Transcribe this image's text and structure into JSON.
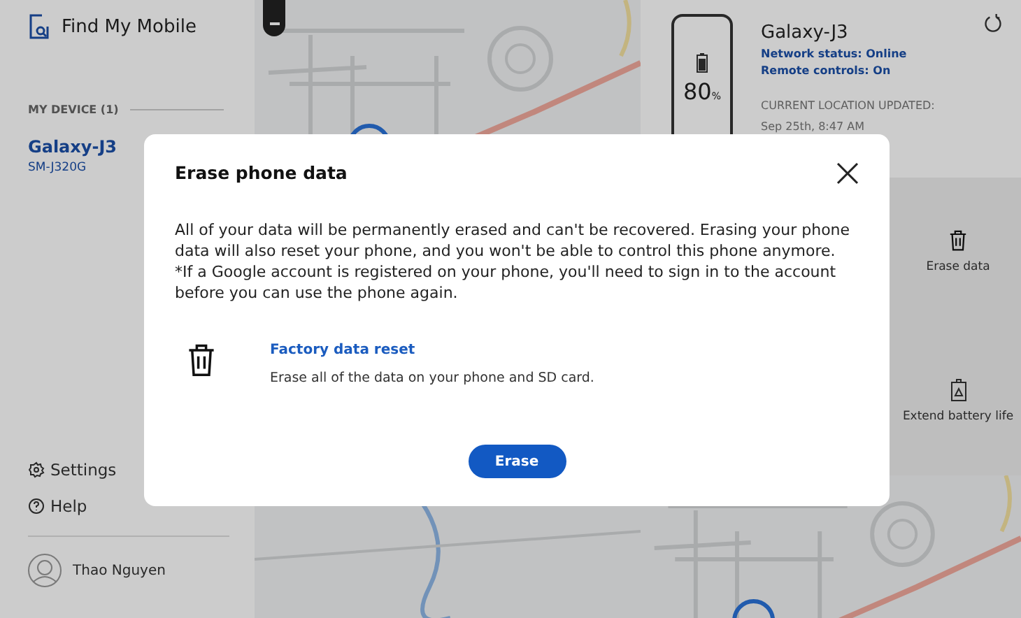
{
  "sidebar": {
    "app_title": "Find My Mobile",
    "section_label": "MY DEVICE (1)",
    "devices": [
      {
        "name": "Galaxy-J3",
        "model": "SM-J320G",
        "selected": true
      }
    ],
    "links": [
      {
        "kind": "settings",
        "label": "Settings"
      },
      {
        "kind": "help",
        "label": "Help"
      }
    ],
    "user": "Thao Nguyen"
  },
  "device_card": {
    "name": "Galaxy-J3",
    "battery": "80",
    "battery_unit": "%",
    "network_status": "Network status: Online",
    "remote_controls": "Remote controls: On",
    "location_label": "CURRENT LOCATION UPDATED:",
    "location_time": "Sep 25th, 8:47 AM"
  },
  "actions": [
    {
      "kind": "erase",
      "label": "Erase data"
    },
    {
      "kind": "battery",
      "label": "Extend battery life"
    }
  ],
  "dialog": {
    "title": "Erase phone data",
    "body": "All of your data will be permanently erased and can't be recovered. Erasing your phone data will also reset your phone, and you won't be able to control this phone anymore.",
    "note": "*If a Google account is registered on your phone, you'll need to sign in to the account before you can use the phone again.",
    "option_title": "Factory data reset",
    "option_text": "Erase all of the data on your phone and SD card.",
    "button": "Erase"
  }
}
